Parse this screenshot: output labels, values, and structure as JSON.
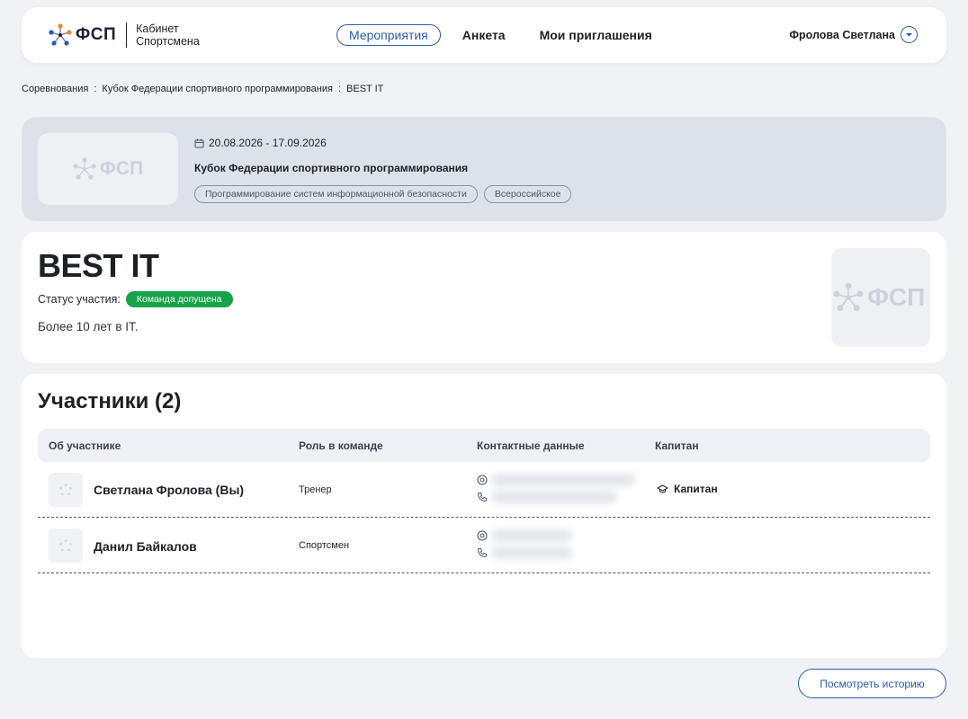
{
  "header": {
    "logo_text": "ФСП",
    "logo_sub_line1": "Кабинет",
    "logo_sub_line2": "Спортсмена",
    "nav": [
      "Мероприятия",
      "Анкета",
      "Мои приглашения"
    ],
    "user_name": "Фролова Светлана",
    "accent_color": "#2a5bb3"
  },
  "breadcrumb": [
    "Соревнования",
    "Кубок Федерации спортивного программирования",
    "BEST IT"
  ],
  "breadcrumb_separator": ":",
  "event": {
    "dates": "20.08.2026 - 17.09.2026",
    "title": "Кубок Федерации спортивного программирования",
    "tags": [
      "Программирование систем информационной безопасности",
      "Всероссийское"
    ],
    "logo_text": "ФСП"
  },
  "team": {
    "name": "BEST IT",
    "status_label": "Статус участия:",
    "status_value": "Команда допущена",
    "status_color": "#17a34a",
    "description": "Более 10 лет в IT.",
    "logo_text": "ФСП"
  },
  "members": {
    "title": "Участники (2)",
    "columns": [
      "Об участнике",
      "Роль в команде",
      "Контактные данные",
      "Капитан"
    ],
    "rows": [
      {
        "name": "Светлана Фролова (Вы)",
        "role": "Тренер",
        "captain": "Капитан"
      },
      {
        "name": "Данил Байкалов",
        "role": "Спортсмен",
        "captain": ""
      }
    ]
  },
  "history_button": "Посмотреть историю"
}
